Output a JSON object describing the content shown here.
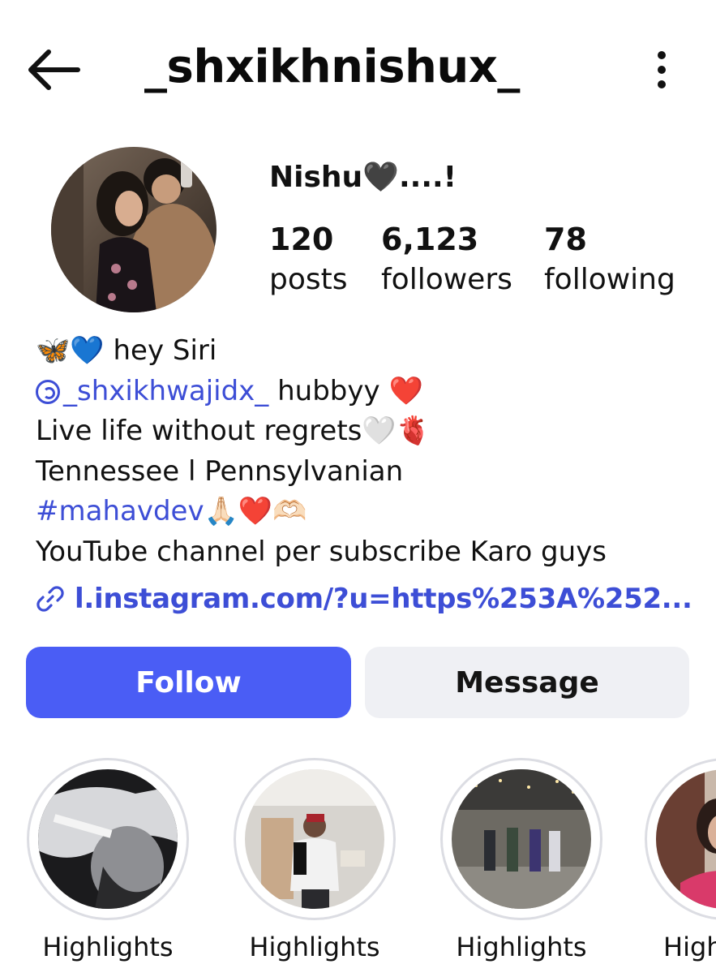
{
  "header": {
    "username": "_shxikhnishux_",
    "back_icon": "arrow-left-icon",
    "menu_icon": "more-vertical-icon"
  },
  "profile": {
    "display_name": "Nishu🖤....!",
    "stats": [
      {
        "value": "120",
        "label": "posts"
      },
      {
        "value": "6,123",
        "label": "followers"
      },
      {
        "value": "78",
        "label": "following"
      }
    ]
  },
  "bio": {
    "line1_emoji": "🦋💙",
    "line1_text": "hey Siri",
    "line2_handle": "_shxikhwajidx_",
    "line2_text": "hubbyy",
    "line2_emoji": "❤️",
    "line3_text": "Live life without regrets",
    "line3_emoji": "🤍🫀",
    "line4_text": "Tennessee l Pennsylvanian",
    "line5_hashtag": "#mahavdev",
    "line5_emoji": "🙏🏻❤️🫶🏻",
    "line6_text": "YouTube channel per subscribe Karo guys",
    "link_icon": "link-icon",
    "link_text": "l.instagram.com/?u=https%253A%252..."
  },
  "actions": {
    "follow_label": "Follow",
    "message_label": "Message"
  },
  "highlights": [
    {
      "label": "Highlights"
    },
    {
      "label": "Highlights"
    },
    {
      "label": "Highlights"
    },
    {
      "label": "High"
    }
  ],
  "colors": {
    "accent_blue": "#4a5df5",
    "link_blue": "#3d4ed6",
    "secondary_button": "#eff0f4",
    "ring": "#dcdde3"
  }
}
